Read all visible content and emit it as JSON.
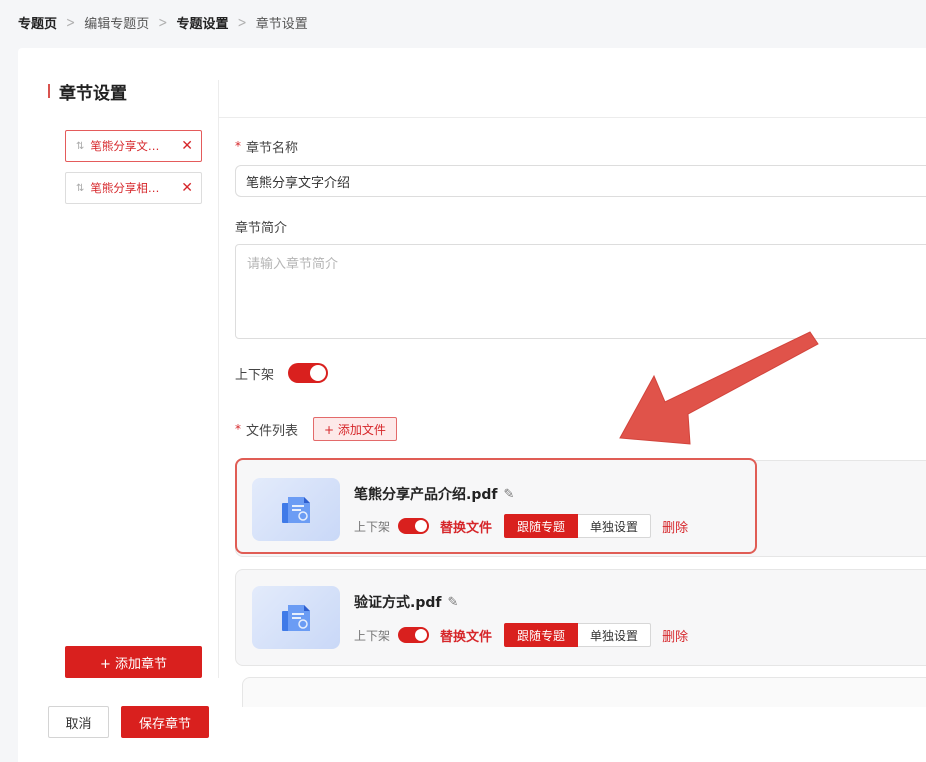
{
  "breadcrumb": [
    {
      "label": "专题页"
    },
    {
      "label": "编辑专题页"
    },
    {
      "label": "专题设置"
    },
    {
      "label": "章节设置"
    }
  ],
  "left_panel": {
    "title": "章节设置",
    "chapters": [
      {
        "label": "笔熊分享文…",
        "active": true
      },
      {
        "label": "笔熊分享相…",
        "active": false
      }
    ],
    "add_chapter_label": "+ 添加章节"
  },
  "form": {
    "name_label": "章节名称",
    "name_value": "笔熊分享文字介绍",
    "intro_label": "章节简介",
    "intro_placeholder": "请输入章节简介",
    "shelf_label": "上下架",
    "shelf_on": true,
    "file_list_label": "文件列表",
    "add_file_label": "+ 添加文件"
  },
  "files": [
    {
      "name": "笔熊分享产品介绍.pdf",
      "shelf_label": "上下架",
      "shelf_on": true,
      "replace_label": "替换文件",
      "follow_label": "跟随专题",
      "separate_label": "单独设置",
      "delete_label": "删除",
      "highlighted": true
    },
    {
      "name": "验证方式.pdf",
      "shelf_label": "上下架",
      "shelf_on": true,
      "replace_label": "替换文件",
      "follow_label": "跟随专题",
      "separate_label": "单独设置",
      "delete_label": "删除",
      "highlighted": false
    }
  ],
  "footer": {
    "cancel_label": "取消",
    "save_label": "保存章节"
  },
  "colors": {
    "accent": "#d9201e",
    "highlight_border": "#e05d55",
    "arrow": "#e0534a"
  },
  "icons": {
    "edit": "pencil-icon",
    "close": "close-icon",
    "drag": "drag-handle-icon",
    "file_thumb": "document-icon"
  }
}
